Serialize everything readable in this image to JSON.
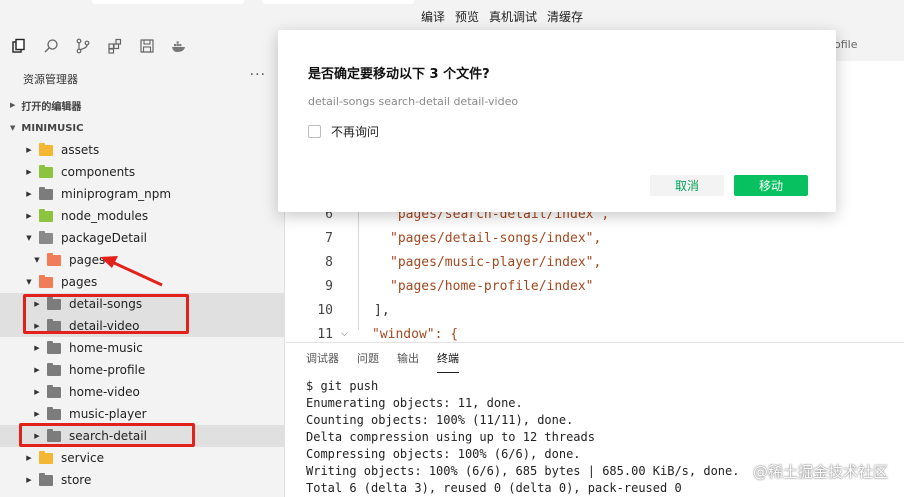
{
  "toolbar": {
    "labels": [
      "编译",
      "预览",
      "真机调试",
      "清缓存"
    ]
  },
  "sidebar": {
    "title": "资源管理器",
    "more": "···",
    "section_open_editors": "打开的编辑器",
    "section_project": "MINIMUSIC",
    "tree": [
      {
        "label": "assets",
        "color": "#f3b733",
        "expanded": false
      },
      {
        "label": "components",
        "color": "#8cc33f",
        "expanded": false
      },
      {
        "label": "miniprogram_npm",
        "color": "#7c7c7c",
        "expanded": false
      },
      {
        "label": "node_modules",
        "color": "#8cc33f",
        "expanded": false
      },
      {
        "label": "packageDetail",
        "color": "#8a8a8a",
        "expanded": true
      },
      {
        "label": "pages",
        "color": "#f07c5a",
        "expanded": true
      },
      {
        "label": "pages",
        "color": "#f07c5a",
        "expanded": true
      },
      {
        "label": "detail-songs",
        "color": "#7c7c7c",
        "expanded": false
      },
      {
        "label": "detail-video",
        "color": "#7c7c7c",
        "expanded": false
      },
      {
        "label": "home-music",
        "color": "#7c7c7c",
        "expanded": false
      },
      {
        "label": "home-profile",
        "color": "#7c7c7c",
        "expanded": false
      },
      {
        "label": "home-video",
        "color": "#7c7c7c",
        "expanded": false
      },
      {
        "label": "music-player",
        "color": "#7c7c7c",
        "expanded": false
      },
      {
        "label": "search-detail",
        "color": "#7c7c7c",
        "expanded": false
      },
      {
        "label": "service",
        "color": "#f3b733",
        "expanded": false
      },
      {
        "label": "store",
        "color": "#7c7c7c",
        "expanded": false
      }
    ]
  },
  "editor": {
    "tab_partial": "ofile",
    "lines": [
      {
        "num": "6",
        "text": "\"pages/search-detail/index\","
      },
      {
        "num": "7",
        "text": "\"pages/detail-songs/index\","
      },
      {
        "num": "8",
        "text": "\"pages/music-player/index\","
      },
      {
        "num": "9",
        "text": "\"pages/home-profile/index\""
      },
      {
        "num": "10",
        "text": "],"
      },
      {
        "num": "11",
        "text": "\"window\": {"
      }
    ]
  },
  "panel": {
    "tabs": [
      "调试器",
      "问题",
      "输出",
      "终端"
    ],
    "active_tab": "终端",
    "terminal": [
      "$ git push",
      "Enumerating objects: 11, done.",
      "Counting objects: 100% (11/11), done.",
      "Delta compression using up to 12 threads",
      "Compressing objects: 100% (6/6), done.",
      "Writing objects: 100% (6/6), 685 bytes | 685.00 KiB/s, done.",
      "Total 6 (delta 3), reused 0 (delta 0), pack-reused 0"
    ],
    "watermark": "@稀土掘金技术社区"
  },
  "dialog": {
    "title": "是否确定要移动以下 3 个文件?",
    "files": "detail-songs search-detail detail-video",
    "checkbox_label": "不再询问",
    "cancel_label": "取消",
    "move_label": "移动"
  },
  "colors": {
    "accent": "#07c160",
    "annotation": "#e3211b"
  }
}
